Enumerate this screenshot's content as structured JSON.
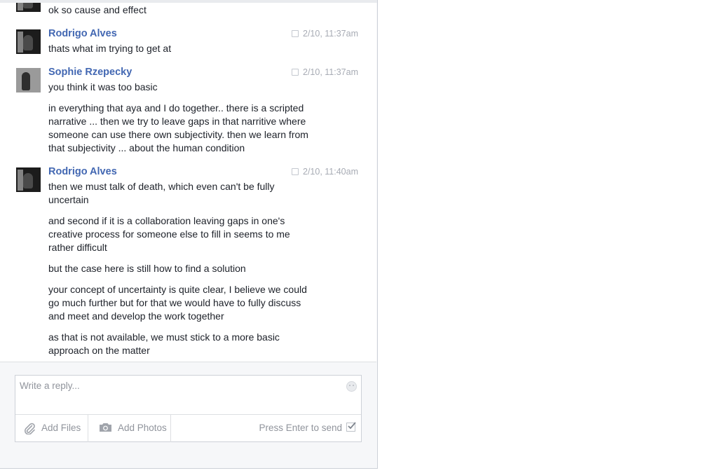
{
  "messages": [
    {
      "author": "",
      "time": "",
      "lines": [
        "ok so cause and effect"
      ]
    },
    {
      "author": "Rodrigo Alves",
      "time": "2/10, 11:37am",
      "lines": [
        "thats what im trying to get at"
      ]
    },
    {
      "author": "Sophie Rzepecky",
      "time": "2/10, 11:37am",
      "lines": [
        "you think it was too basic",
        "in everything that aya and I do together.. there is a scripted narrative ... then we try to leave gaps in that narritive where someone can use there own subjectivity. then we learn from that subjectivity ... about the human condition"
      ]
    },
    {
      "author": "Rodrigo Alves",
      "time": "2/10, 11:40am",
      "lines": [
        "then we must talk of death, which even can't be fully uncertain",
        "and second if it is a collaboration leaving gaps in one's creative process for someone else to fill in seems to me rather difficult",
        "but the case here is still how to find a solution",
        "your concept of uncertainty is quite clear, I believe we could go much further but for that we would have to fully discuss and meet and develop the work together",
        "as that is not available, we must stick to a more basic approach on the matter"
      ]
    }
  ],
  "composer": {
    "placeholder": "Write a reply...",
    "value": "",
    "add_files": "Add Files",
    "add_photos": "Add Photos",
    "press_enter": "Press Enter to send",
    "press_enter_checked": true
  },
  "icons": {
    "clip": "paperclip-icon",
    "camera": "camera-icon",
    "emoji": "emoji-icon",
    "checkbox": "checkbox-icon",
    "avatar": "avatar"
  },
  "colors": {
    "author_name": "#4267b2",
    "timestamp": "#a7abb4",
    "text": "#1d2129",
    "placeholder": "#90949c"
  }
}
